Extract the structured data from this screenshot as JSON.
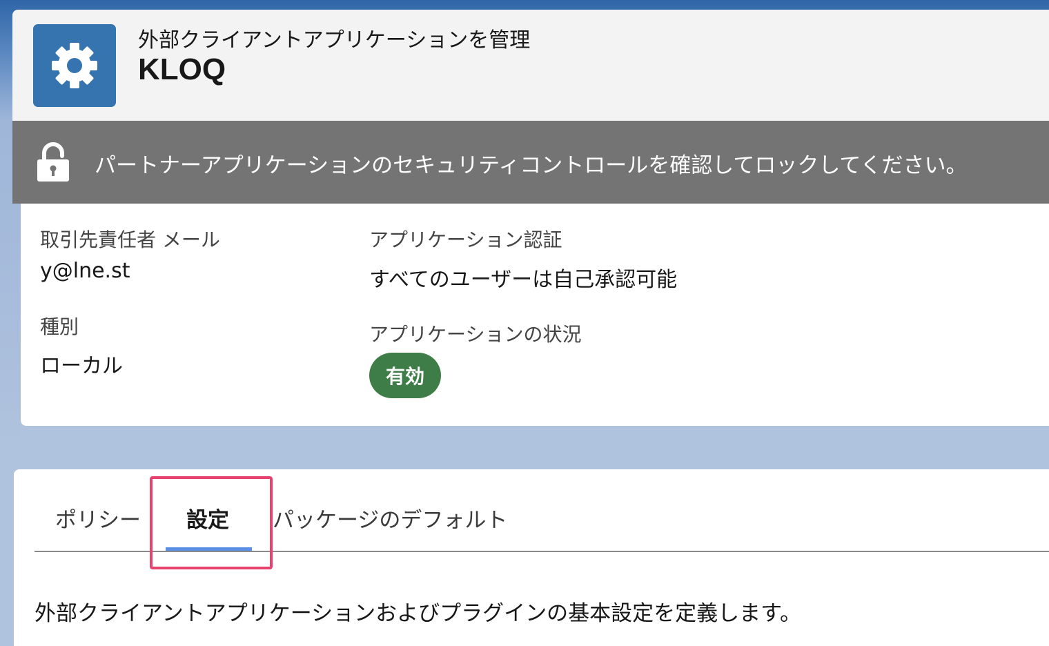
{
  "header": {
    "subtitle": "外部クライアントアプリケーションを管理",
    "title": "KLOQ"
  },
  "banner": {
    "text": "パートナーアプリケーションのセキュリティコントロールを確認してロックしてください。"
  },
  "details": {
    "contact_email_label": "取引先責任者 メール",
    "contact_email_value": "y@lne.st",
    "type_label": "種別",
    "type_value": "ローカル",
    "app_auth_label": "アプリケーション認証",
    "app_auth_value": "すべてのユーザーは自己承認可能",
    "app_status_label": "アプリケーションの状況",
    "app_status_value": "有効"
  },
  "tabs": [
    {
      "label": "ポリシー",
      "active": false
    },
    {
      "label": "設定",
      "active": true
    },
    {
      "label": "パッケージのデフォルト",
      "active": false
    }
  ],
  "tab_content": {
    "description": "外部クライアントアプリケーションおよびプラグインの基本設定を定義します。"
  },
  "icons": {
    "app": "gear-icon",
    "banner": "lock-icon"
  },
  "colors": {
    "app_icon_bg": "#3574ae",
    "banner_bg": "#747474",
    "status_active": "#3e7d47",
    "tab_underline": "#5a8fe6",
    "highlight": "#e8426e"
  }
}
